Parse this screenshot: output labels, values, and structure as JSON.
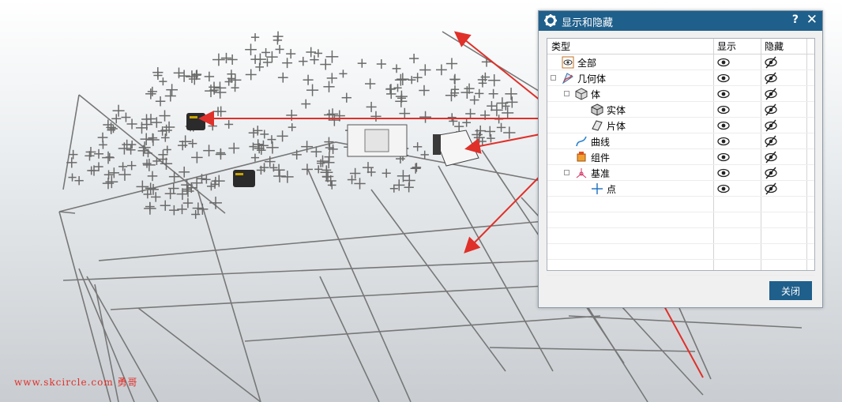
{
  "dialog": {
    "title": "显示和隐藏",
    "help_label": "?",
    "close_x_label": "✕",
    "columns": {
      "type": "类型",
      "show": "显示",
      "hide": "隐藏"
    },
    "rows": [
      {
        "label": "全部",
        "icon": "all-icon",
        "level": 0,
        "expander": false
      },
      {
        "label": "几何体",
        "icon": "geometry-icon",
        "level": 0,
        "expander": "-"
      },
      {
        "label": "体",
        "icon": "body-icon",
        "level": 1,
        "expander": "-"
      },
      {
        "label": "实体",
        "icon": "solid-body-icon",
        "level": 2,
        "expander": false
      },
      {
        "label": "片体",
        "icon": "sheet-body-icon",
        "level": 2,
        "expander": false
      },
      {
        "label": "曲线",
        "icon": "curve-icon",
        "level": 1,
        "expander": false
      },
      {
        "label": "组件",
        "icon": "component-icon",
        "level": 1,
        "expander": false
      },
      {
        "label": "基准",
        "icon": "datum-icon",
        "level": 1,
        "expander": "-"
      },
      {
        "label": "点",
        "icon": "point-icon",
        "level": 2,
        "expander": false
      }
    ],
    "close_button": "关闭"
  },
  "watermark": "www.skcircle.com  勇哥",
  "colors": {
    "titlebar": "#1f5f8b",
    "arrow": "#e0302a",
    "wireframe": "#707070"
  }
}
